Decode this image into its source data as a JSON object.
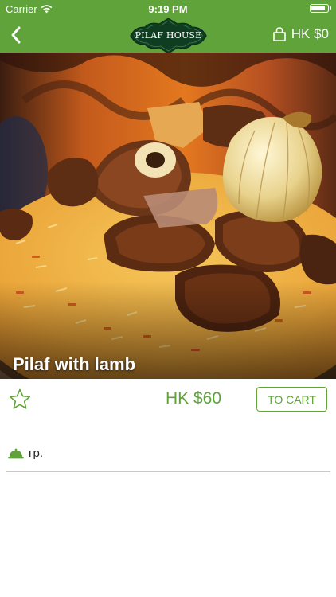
{
  "status_bar": {
    "carrier": "Carrier",
    "time": "9:19 PM"
  },
  "nav": {
    "logo_text": "PILAF HOUSE",
    "cart_total": "HK $0",
    "icons": {
      "back": "chevron-left-icon",
      "cart": "shopping-bag-icon"
    }
  },
  "product": {
    "name": "Pilaf with lamb",
    "price": "HK $60",
    "to_cart_label": "TO CART",
    "weight_unit": "гр.",
    "favorite_icon": "star-outline-icon",
    "weight_icon": "cloche-icon"
  },
  "colors": {
    "brand_green": "#60a33b",
    "logo_dark": "#0f3d22",
    "divider": "#c9c9c9"
  }
}
